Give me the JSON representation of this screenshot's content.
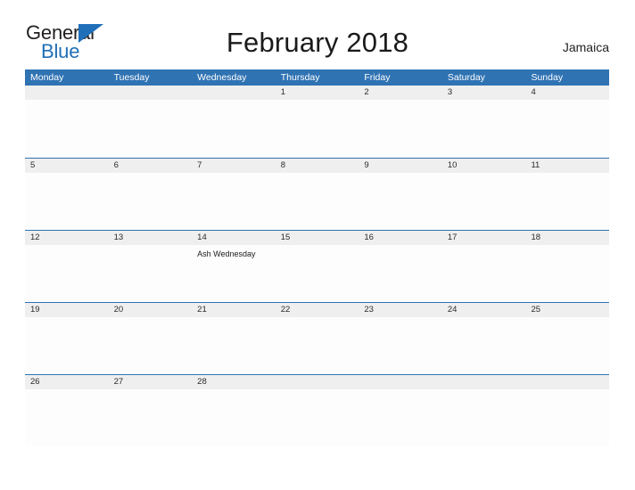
{
  "brand": {
    "name_part1": "General",
    "name_part2": "Blue",
    "flag_icon": "blue-triangle-flag-icon",
    "color_primary": "#1f6fb8",
    "color_text": "#231f20"
  },
  "header": {
    "title": "February 2018",
    "region": "Jamaica"
  },
  "calendar": {
    "month": "February",
    "year": "2018",
    "accent_color": "#2f73b3",
    "strip_color": "#efefef",
    "weekday_headers": [
      "Monday",
      "Tuesday",
      "Wednesday",
      "Thursday",
      "Friday",
      "Saturday",
      "Sunday"
    ],
    "weeks": [
      [
        {
          "date": "",
          "events": []
        },
        {
          "date": "",
          "events": []
        },
        {
          "date": "",
          "events": []
        },
        {
          "date": "1",
          "events": []
        },
        {
          "date": "2",
          "events": []
        },
        {
          "date": "3",
          "events": []
        },
        {
          "date": "4",
          "events": []
        }
      ],
      [
        {
          "date": "5",
          "events": []
        },
        {
          "date": "6",
          "events": []
        },
        {
          "date": "7",
          "events": []
        },
        {
          "date": "8",
          "events": []
        },
        {
          "date": "9",
          "events": []
        },
        {
          "date": "10",
          "events": []
        },
        {
          "date": "11",
          "events": []
        }
      ],
      [
        {
          "date": "12",
          "events": []
        },
        {
          "date": "13",
          "events": []
        },
        {
          "date": "14",
          "events": [
            "Ash Wednesday"
          ]
        },
        {
          "date": "15",
          "events": []
        },
        {
          "date": "16",
          "events": []
        },
        {
          "date": "17",
          "events": []
        },
        {
          "date": "18",
          "events": []
        }
      ],
      [
        {
          "date": "19",
          "events": []
        },
        {
          "date": "20",
          "events": []
        },
        {
          "date": "21",
          "events": []
        },
        {
          "date": "22",
          "events": []
        },
        {
          "date": "23",
          "events": []
        },
        {
          "date": "24",
          "events": []
        },
        {
          "date": "25",
          "events": []
        }
      ],
      [
        {
          "date": "26",
          "events": []
        },
        {
          "date": "27",
          "events": []
        },
        {
          "date": "28",
          "events": []
        },
        {
          "date": "",
          "events": []
        },
        {
          "date": "",
          "events": []
        },
        {
          "date": "",
          "events": []
        },
        {
          "date": "",
          "events": []
        }
      ]
    ]
  }
}
